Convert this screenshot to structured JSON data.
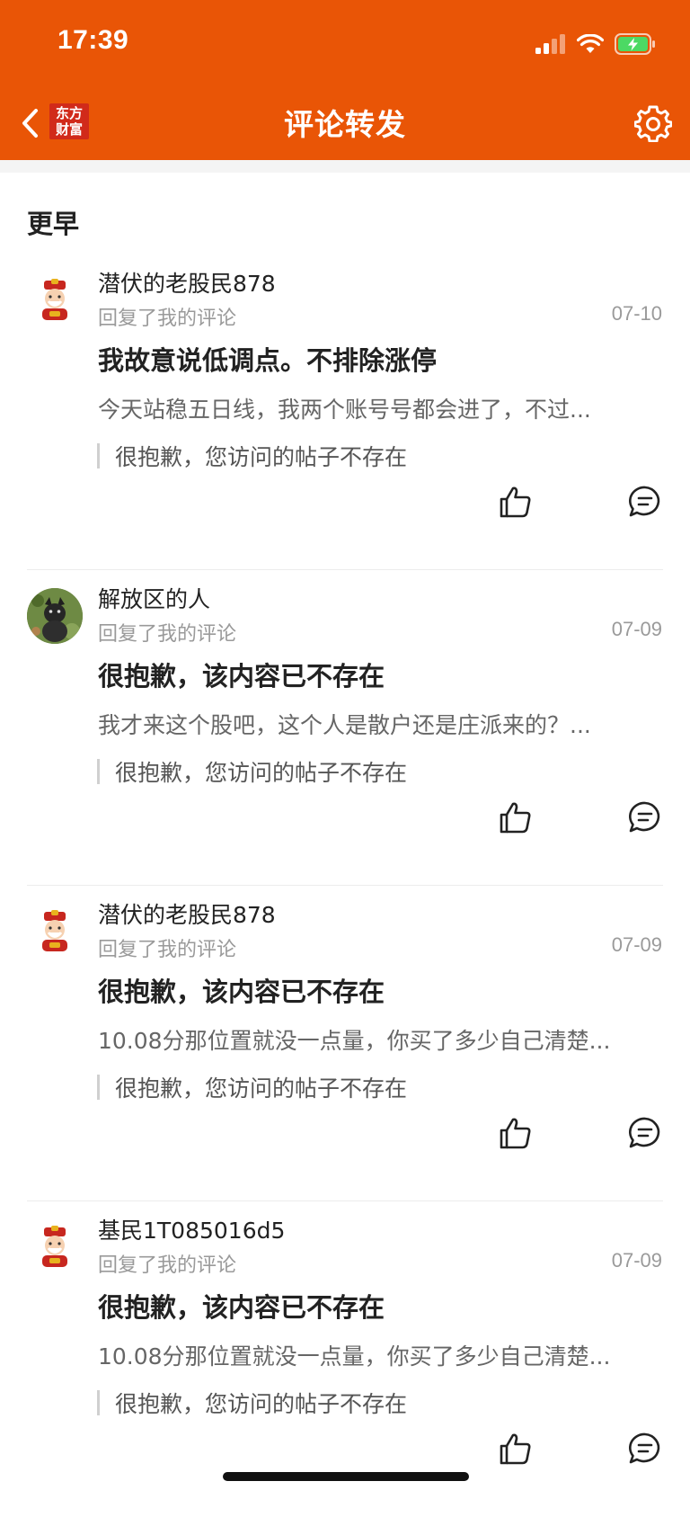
{
  "status_bar": {
    "time": "17:39"
  },
  "nav": {
    "logo_line1": "东方",
    "logo_line2": "财富",
    "title": "评论转发"
  },
  "section_title": "更早",
  "items": [
    {
      "username": "潜伏的老股民878",
      "reply_label": "回复了我的评论",
      "date": "07-10",
      "title": "我故意说低调点。不排除涨停",
      "body": "今天站稳五日线，我两个账号号都会进了，不过...",
      "quote": "很抱歉，您访问的帖子不存在",
      "avatar": "cartoon"
    },
    {
      "username": "解放区的人",
      "reply_label": "回复了我的评论",
      "date": "07-09",
      "title": "很抱歉，该内容已不存在",
      "body": "我才来这个股吧，这个人是散户还是庄派来的？...",
      "quote": "很抱歉，您访问的帖子不存在",
      "avatar": "photo"
    },
    {
      "username": "潜伏的老股民878",
      "reply_label": "回复了我的评论",
      "date": "07-09",
      "title": "很抱歉，该内容已不存在",
      "body": "10.08分那位置就没一点量，你买了多少自己清楚...",
      "quote": "很抱歉，您访问的帖子不存在",
      "avatar": "cartoon"
    },
    {
      "username": "基民1T085016d5",
      "reply_label": "回复了我的评论",
      "date": "07-09",
      "title": "很抱歉，该内容已不存在",
      "body": "10.08分那位置就没一点量，你买了多少自己清楚...",
      "quote": "很抱歉，您访问的帖子不存在",
      "avatar": "cartoon"
    }
  ],
  "colors": {
    "header": "#e95506",
    "logo_bg": "#d12a1a",
    "battery": "#4cd964"
  }
}
